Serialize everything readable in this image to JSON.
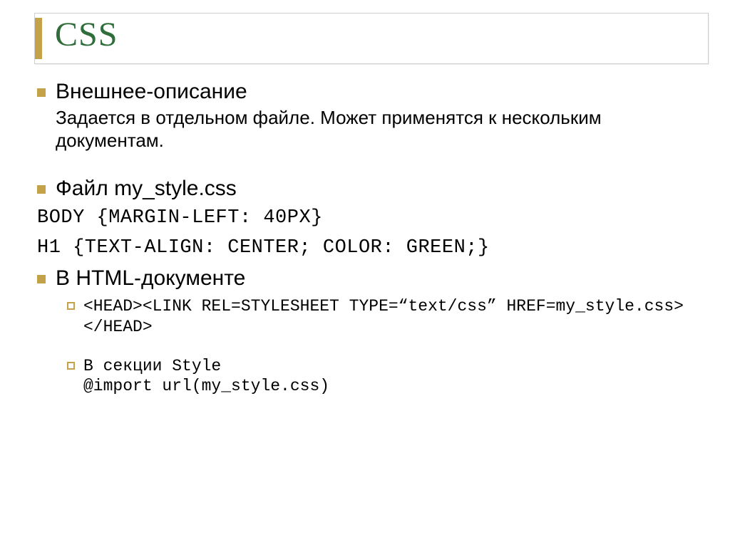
{
  "title": "CSS",
  "item1": {
    "heading": "Внешнее-описание",
    "desc": "Задается в отдельном файле. Может применятся к нескольким документам."
  },
  "item2": {
    "heading": "Файл my_style.css",
    "code1": "BODY {MARGIN-LEFT: 40PX}",
    "code2": "H1 {TEXT-ALIGN: CENTER; COLOR: GREEN;}"
  },
  "item3": {
    "heading": "В HTML-документе",
    "sub1": "<HEAD><LINK REL=STYLESHEET TYPE=“text/css” HREF=my_style.css></HEAD>",
    "sub2a": "В секции Style",
    "sub2b": "@import url(my_style.css)"
  }
}
